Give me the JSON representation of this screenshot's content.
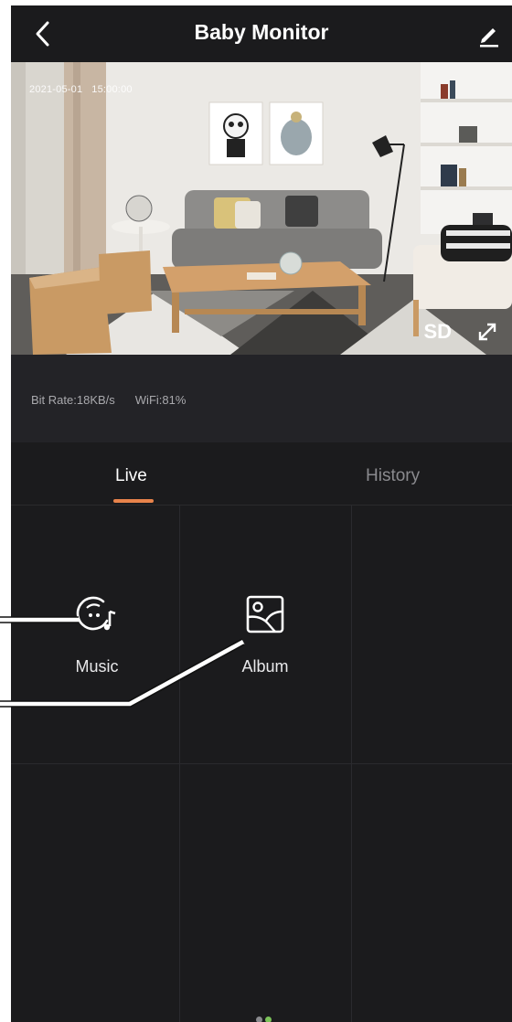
{
  "header": {
    "title": "Baby Monitor",
    "back_icon": "chevron-left-icon",
    "edit_icon": "edit-pencil-icon"
  },
  "video": {
    "date": "2021-05-01",
    "time": "15:00:00",
    "quality_label": "SD",
    "fullscreen_icon": "expand-diagonal-icon"
  },
  "stats": {
    "bit_rate": "Bit Rate:18KB/s",
    "wifi": "WiFi:81%"
  },
  "tabs": [
    {
      "label": "Live",
      "active": true
    },
    {
      "label": "History",
      "active": false
    }
  ],
  "features": [
    {
      "label": "Music",
      "icon": "music-face-icon"
    },
    {
      "label": "Album",
      "icon": "album-image-icon"
    }
  ],
  "colors": {
    "background": "#1b1b1d",
    "accent": "#e8834b",
    "page_indicator_active": "#7cc35a",
    "page_indicator_inactive": "#8a8a8e"
  }
}
